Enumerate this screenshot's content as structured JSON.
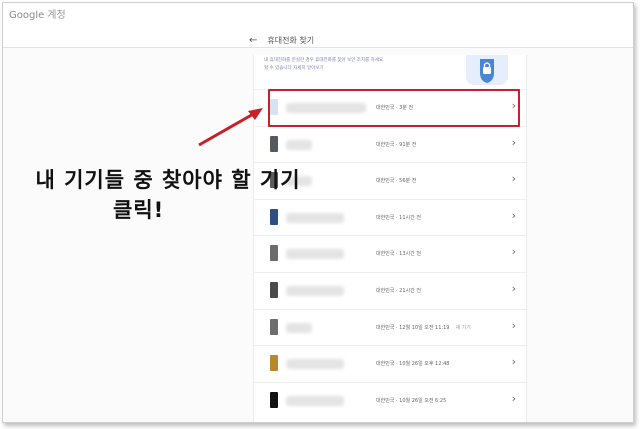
{
  "app": {
    "brand": "Google",
    "account_label": "계정"
  },
  "header": {
    "back_icon": "arrow-left-icon",
    "title": "휴대전화 찾기"
  },
  "intro": {
    "lines": [
      "내 휴대전화를 분실한 경우 휴대전화를 찾아 보안 조치를 하세요.",
      "할 수 있습니다 자세히 알아보기"
    ]
  },
  "devices": [
    {
      "location": "대한민국 · 3분 전",
      "extra": "",
      "thumb_color": "#d9e3ef",
      "name_width": "wide"
    },
    {
      "location": "대한민국 · 91분 전",
      "extra": "",
      "thumb_color": "#555a60",
      "name_width": "short"
    },
    {
      "location": "대한민국 · 56분 전",
      "extra": "",
      "thumb_color": "#5b5b5b",
      "name_width": "short"
    },
    {
      "location": "대한민국 · 11시간 전",
      "extra": "",
      "thumb_color": "#2d4f86",
      "name_width": "mid"
    },
    {
      "location": "대한민국 · 13시간 전",
      "extra": "",
      "thumb_color": "#6b6b6b",
      "name_width": "mid"
    },
    {
      "location": "대한민국 · 21시간 전",
      "extra": "",
      "thumb_color": "#4a4a4a",
      "name_width": "mid"
    },
    {
      "location": "대한민국 · 12월 10일 오전 11:19",
      "extra": "새 기기",
      "thumb_color": "#6e6e6e",
      "name_width": "short"
    },
    {
      "location": "대한민국 · 10월 26일 오후 12:48",
      "extra": "",
      "thumb_color": "#b8892b",
      "name_width": "mid"
    },
    {
      "location": "대한민국 · 10월 26일 오전 6:25",
      "extra": "",
      "thumb_color": "#111111",
      "name_width": "mid"
    }
  ],
  "annotation": {
    "line1": "내 기기들 중 찾아야 할 기기",
    "line2": "클릭!",
    "highlight_color": "#c8202a"
  }
}
